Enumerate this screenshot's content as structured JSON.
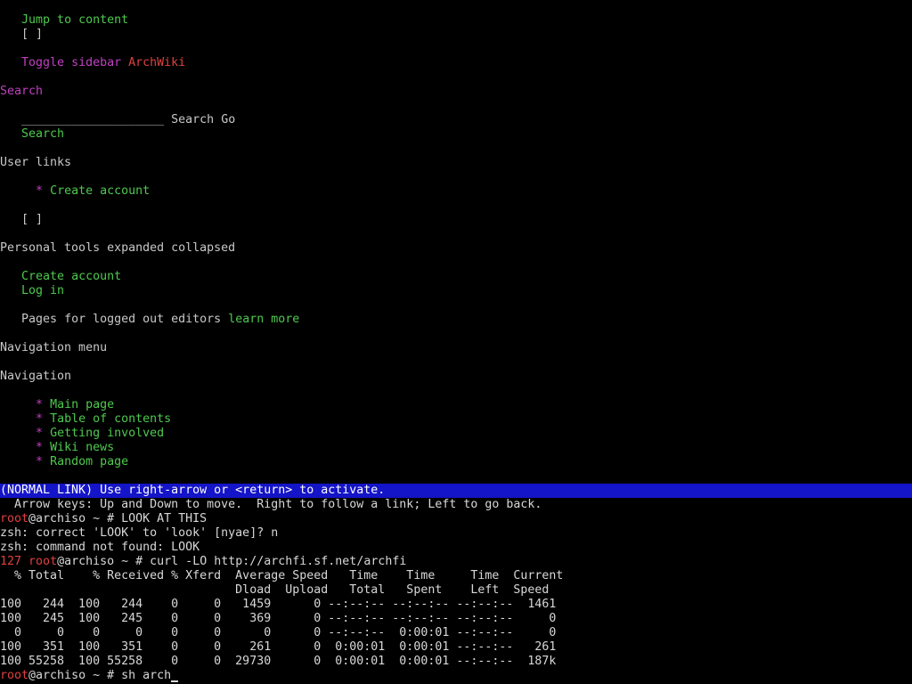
{
  "browser": {
    "skip_link": "Jump to content",
    "checkbox_1": "[ ]",
    "toggle_sidebar": "Toggle sidebar",
    "site_name": "ArchWiki",
    "search_heading": "Search",
    "search_input_value": "____________________",
    "search_button": "Search",
    "go_button": "Go",
    "search_link": "Search",
    "user_links_heading": "User links",
    "create_account_bullet": "Create account",
    "checkbox_2": "[ ]",
    "personal_tools": "Personal tools expanded collapsed",
    "create_account": "Create account",
    "log_in": "Log in",
    "logged_out_text": "Pages for logged out editors",
    "learn_more": "learn more",
    "nav_menu_heading": "Navigation menu",
    "navigation_heading": "Navigation",
    "nav_items": [
      "Main page",
      "Table of contents",
      "Getting involved",
      "Wiki news",
      "Random page"
    ],
    "bullet": "*"
  },
  "statusbar": {
    "text": "(NORMAL LINK) Use right-arrow or <return> to activate."
  },
  "terminal": {
    "help_line": "  Arrow keys: Up and Down to move.  Right to follow a link; Left to go back.",
    "user": "root",
    "host_prompt": "@archiso ~ # ",
    "cmd1": "LOOK AT THIS",
    "correct_line": "zsh: correct 'LOOK' to 'look' [nyae]? n",
    "notfound_line": "zsh: command not found: LOOK",
    "exit_code": "127",
    "cmd2": "curl -LO http://archfi.sf.net/archfi",
    "curl_header1": "  % Total    % Received % Xferd  Average Speed   Time    Time     Time  Current",
    "curl_header2": "                                 Dload  Upload   Total   Spent    Left  Speed",
    "curl_rows": [
      "100   244  100   244    0     0   1459      0 --:--:-- --:--:-- --:--:--  1461",
      "100   245  100   245    0     0    369      0 --:--:-- --:--:-- --:--:--     0",
      "  0     0    0     0    0     0      0      0 --:--:--  0:00:01 --:--:--     0",
      "100   351  100   351    0     0    261      0  0:00:01  0:00:01 --:--:--   261",
      "100 55258  100 55258    0     0  29730      0  0:00:01  0:00:01 --:--:--  187k"
    ],
    "cmd3": "sh arch"
  }
}
